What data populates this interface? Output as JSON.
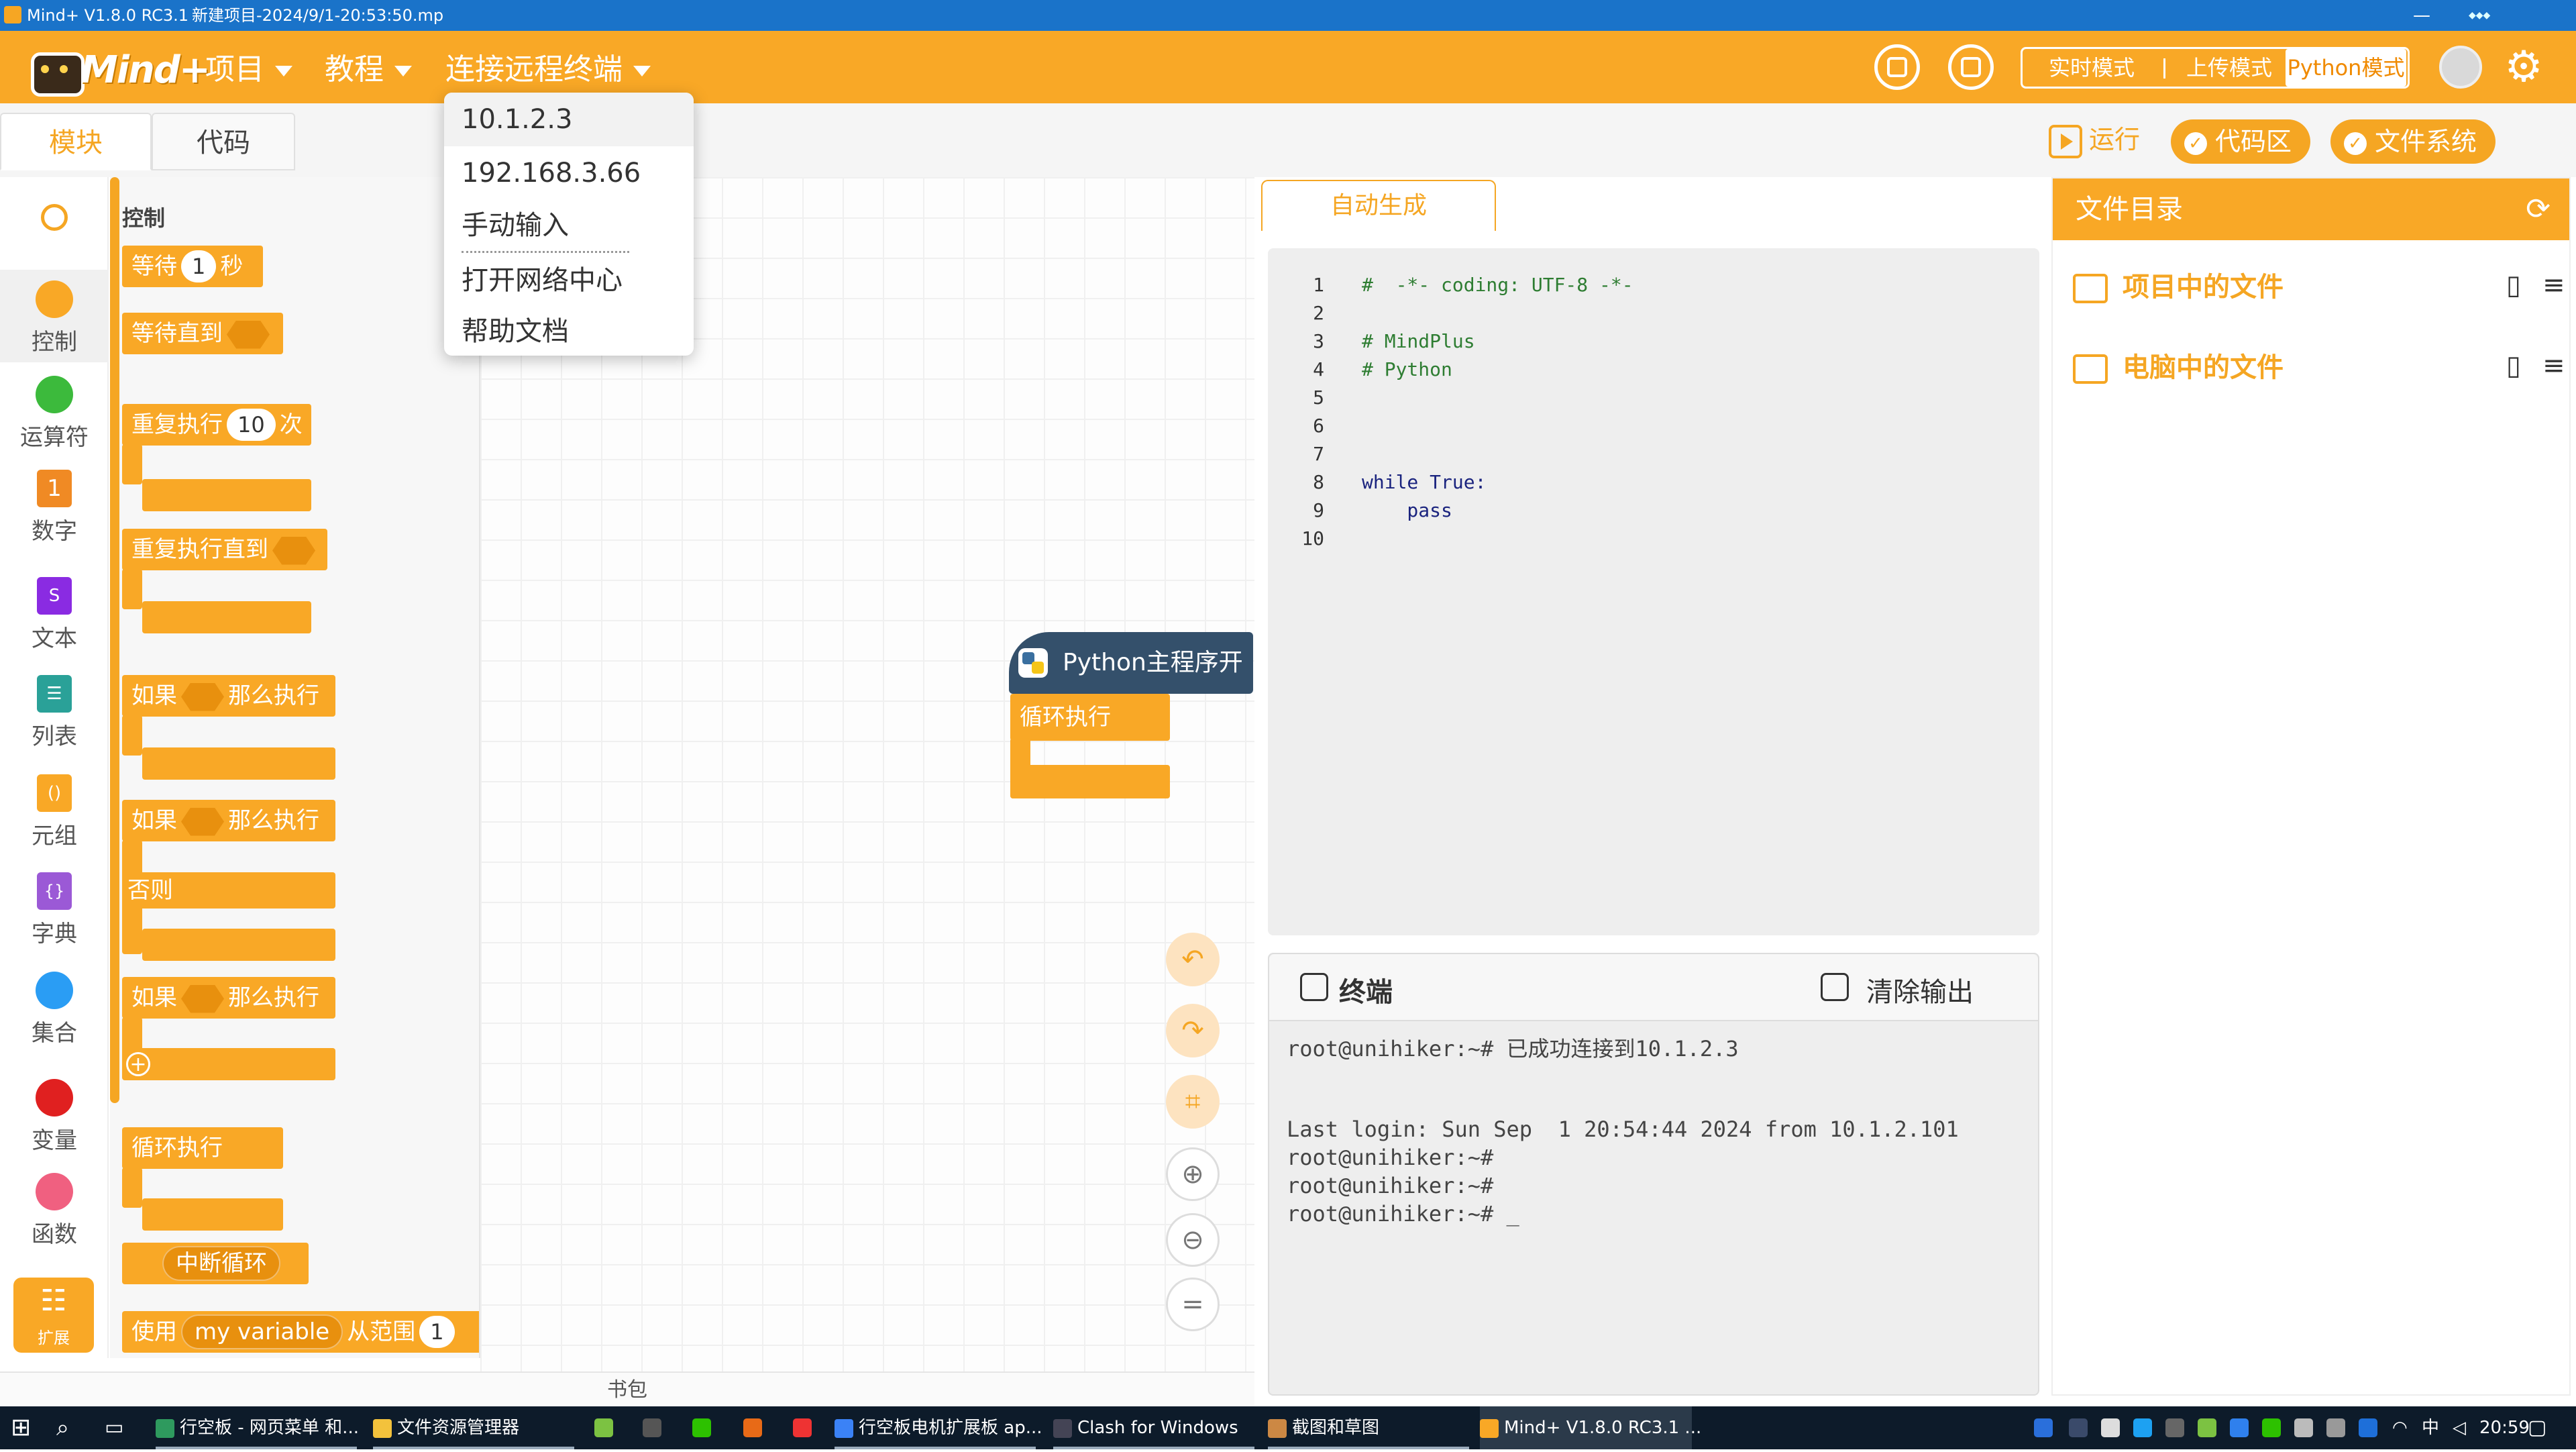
{
  "titlebar": {
    "app_title": "Mind+ V1.8.0 RC3.1",
    "project_file": "新建项目-2024/9/1-20:53:50.mp",
    "minimize": "—",
    "maximize": "☐",
    "close": "✕"
  },
  "menubar": {
    "brand": "Mind+",
    "project": "项目",
    "tutorial": "教程",
    "remote_terminal": "连接远程终端",
    "mode_realtime": "实时模式",
    "mode_upload": "上传模式",
    "mode_python": "Python模式",
    "accent": "#f9a826"
  },
  "dropdown": {
    "items": [
      "10.1.2.3",
      "192.168.3.66",
      "手动输入",
      "打开网络中心",
      "帮助文档"
    ]
  },
  "tabs": {
    "blocks": "模块",
    "code": "代码",
    "run": "运行",
    "code_area": "代码区",
    "file_system": "文件系统"
  },
  "categories": [
    {
      "label": "控制",
      "color": "#f9a826"
    },
    {
      "label": "运算符",
      "color": "#3cba3c"
    },
    {
      "label": "数字",
      "color": "#f08a24"
    },
    {
      "label": "文本",
      "color": "#8a2be2"
    },
    {
      "label": "列表",
      "color": "#2aa198"
    },
    {
      "label": "元组",
      "color": "#f9a826"
    },
    {
      "label": "字典",
      "color": "#9b59d6"
    },
    {
      "label": "集合",
      "color": "#2a9df4"
    },
    {
      "label": "变量",
      "color": "#e02020"
    },
    {
      "label": "函数",
      "color": "#f06080"
    }
  ],
  "extension": "扩展",
  "palette": {
    "title": "控制",
    "wait": "等待",
    "wait_value": "1",
    "wait_unit": "秒",
    "wait_until": "等待直到",
    "repeat": "重复执行",
    "repeat_value": "10",
    "repeat_unit": "次",
    "repeat_until": "重复执行直到",
    "if1": "如果",
    "then1": "那么执行",
    "if2": "如果",
    "then2": "那么执行",
    "else": "否则",
    "if3": "如果",
    "then3": "那么执行",
    "loop": "循环执行",
    "break_loop": "中断循环",
    "use": "使用",
    "my_variable": "my variable",
    "from_range": "从范围",
    "range_value": "1"
  },
  "workspace": {
    "hat_block": "Python主程序开始",
    "loop_block": "循环执行"
  },
  "backpack": "书包",
  "code_panel": {
    "tab": "自动生成",
    "lines": [
      {
        "n": "1",
        "code": "#  -*- coding: UTF-8 -*-"
      },
      {
        "n": "2",
        "code": ""
      },
      {
        "n": "3",
        "code": "# MindPlus"
      },
      {
        "n": "4",
        "code": "# Python"
      },
      {
        "n": "5",
        "code": ""
      },
      {
        "n": "6",
        "code": ""
      },
      {
        "n": "7",
        "code": ""
      },
      {
        "n": "8",
        "code": "while True:"
      },
      {
        "n": "9",
        "code": "    pass"
      },
      {
        "n": "10",
        "code": ""
      }
    ]
  },
  "terminal": {
    "title": "终端",
    "clear": "清除输出",
    "lines": [
      "root@unihiker:~# 已成功连接到10.1.2.3",
      "",
      "",
      "Last login: Sun Sep  1 20:54:44 2024 from 10.1.2.101",
      "root@unihiker:~#",
      "root@unihiker:~#",
      "root@unihiker:~# _"
    ]
  },
  "file_directory": {
    "title": "文件目录",
    "project_files": "项目中的文件",
    "computer_files": "电脑中的文件"
  },
  "taskbar": {
    "items": [
      "行空板 - 网页菜单 和...",
      "文件资源管理器",
      "行空板电机扩展板 ap...",
      "Clash for Windows",
      "截图和草图",
      "Mind+ V1.8.0 RC3.1 ..."
    ],
    "ime": "中",
    "time": "20:59"
  }
}
